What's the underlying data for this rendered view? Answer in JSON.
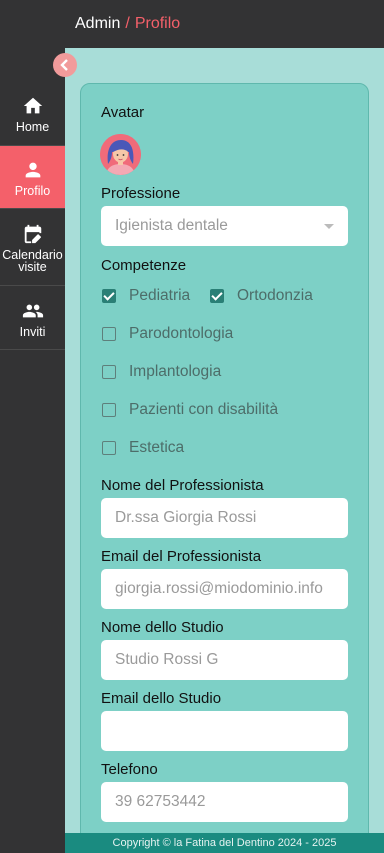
{
  "sidebar": {
    "items": [
      {
        "label": "Home",
        "icon": "home-icon"
      },
      {
        "label": "Profilo",
        "icon": "person-icon"
      },
      {
        "label": "Calendario visite",
        "icon": "calendar-edit-icon"
      },
      {
        "label": "Inviti",
        "icon": "people-icon"
      }
    ],
    "active_index": 1
  },
  "header": {
    "root": "Admin",
    "separator": "/",
    "current": "Profilo"
  },
  "form": {
    "avatar_label": "Avatar",
    "profession_label": "Professione",
    "profession_value": "Igienista dentale",
    "skills_label": "Competenze",
    "skills": [
      {
        "label": "Pediatria",
        "checked": true
      },
      {
        "label": "Ortodonzia",
        "checked": true
      },
      {
        "label": "Parodontologia",
        "checked": false
      },
      {
        "label": "Implantologia",
        "checked": false
      },
      {
        "label": "Pazienti con disabilità",
        "checked": false
      },
      {
        "label": "Estetica",
        "checked": false
      }
    ],
    "professional_name_label": "Nome del Professionista",
    "professional_name_value": "Dr.ssa Giorgia Rossi",
    "professional_email_label": "Email del Professionista",
    "professional_email_value": "giorgia.rossi@miodominio.info",
    "studio_name_label": "Nome dello Studio",
    "studio_name_value": "Studio Rossi G",
    "studio_email_label": "Email dello Studio",
    "studio_email_value": "",
    "phone_label": "Telefono",
    "phone_value": "39 62753442"
  },
  "footer": {
    "text": "Copyright © la Fatina del Dentino 2024 - 2025"
  },
  "colors": {
    "sidebar": "#333334",
    "accent": "#f4606a",
    "card": "#7dd0c6",
    "background": "#a8ddd8",
    "footer": "#1a8b80"
  }
}
